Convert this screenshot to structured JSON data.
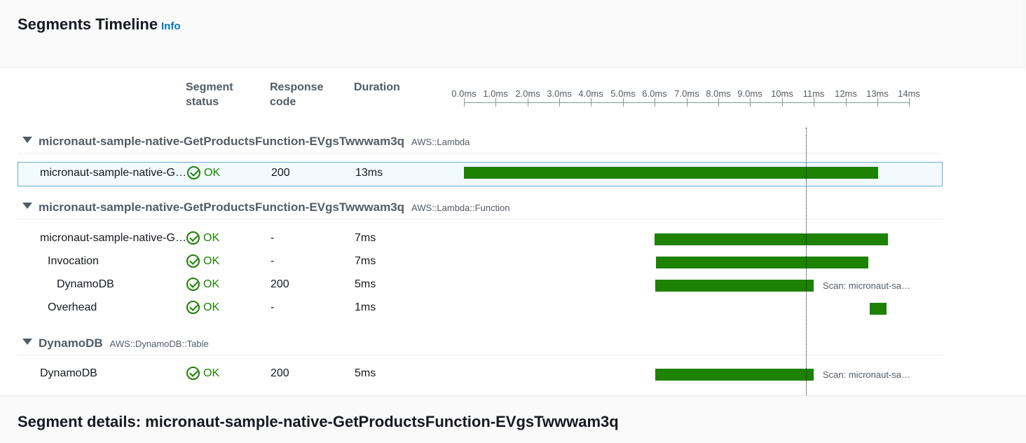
{
  "header": {
    "title": "Segments Timeline",
    "info": "Info"
  },
  "columns": {
    "status_line1": "Segment",
    "status_line2": "status",
    "code_line1": "Response",
    "code_line2": "code",
    "duration": "Duration"
  },
  "axis": {
    "ticks": [
      "0.0ms",
      "1.0ms",
      "2.0ms",
      "3.0ms",
      "4.0ms",
      "5.0ms",
      "6.0ms",
      "7.0ms",
      "8.0ms",
      "9.0ms",
      "10ms",
      "11ms",
      "12ms",
      "13ms",
      "14ms"
    ]
  },
  "groups": [
    {
      "name": "micronaut-sample-native-GetProductsFunction-EVgsTwwwam3q",
      "type": "AWS::Lambda"
    },
    {
      "name": "micronaut-sample-native-GetProductsFunction-EVgsTwwwam3q",
      "type": "AWS::Lambda::Function"
    },
    {
      "name": "DynamoDB",
      "type": "AWS::DynamoDB::Table"
    }
  ],
  "rows": [
    {
      "name": "micronaut-sample-native-GetProductsFunction-EVgsTwwwam3q",
      "status": "OK",
      "code": "200",
      "duration": "13ms",
      "label": ""
    },
    {
      "name": "micronaut-sample-native-GetProductsFunction-EVgsTwwwam3q",
      "status": "OK",
      "code": "-",
      "duration": "7ms",
      "label": ""
    },
    {
      "name": "Invocation",
      "status": "OK",
      "code": "-",
      "duration": "7ms",
      "label": ""
    },
    {
      "name": "DynamoDB",
      "status": "OK",
      "code": "200",
      "duration": "5ms",
      "label": "Scan: micronaut-sa…"
    },
    {
      "name": "Overhead",
      "status": "OK",
      "code": "-",
      "duration": "1ms",
      "label": ""
    },
    {
      "name": "DynamoDB",
      "status": "OK",
      "code": "200",
      "duration": "5ms",
      "label": "Scan: micronaut-sa…"
    }
  ],
  "footer": {
    "title": "Segment details: micronaut-sample-native-GetProductsFunction-EVgsTwwwam3q"
  }
}
